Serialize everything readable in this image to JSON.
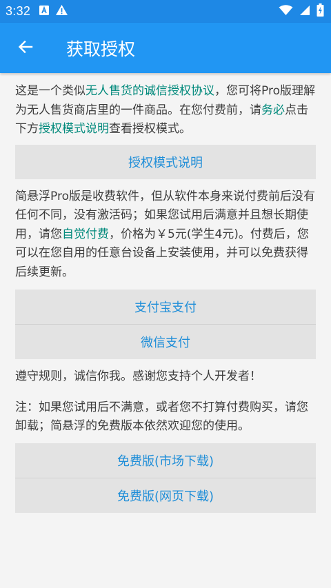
{
  "status_bar": {
    "time": "3:32",
    "left_icons": [
      "font-download-icon",
      "warning-icon"
    ],
    "right_icons": [
      "wifi-icon",
      "signal-icon",
      "battery-charging-icon"
    ]
  },
  "app_bar": {
    "back_icon": "arrow-left-icon",
    "title": "获取授权"
  },
  "intro": {
    "t1": "这是一个类似",
    "h1": "无人售货的诚信授权协议",
    "t2": "，您可将Pro版理解为无人售货商店里的一件商品。在您付费前，请",
    "h2": "务必",
    "t3": "点击下方",
    "h3": "授权模式说明",
    "t4": "查看授权模式。"
  },
  "auth_mode_button": "授权模式说明",
  "pricing": {
    "t1": "简悬浮Pro版是收费软件，但从软件本身来说付费前后没有任何不同，没有激活码；如果您试用后满意并且想长期使用，请您",
    "h1": "自觉付费",
    "t2": "，价格为￥5元(学生4元)。付费后，您可以在您自用的任意台设备上安装使用，并可以免费获得后续更新。"
  },
  "payment_buttons": {
    "alipay": "支付宝支付",
    "wechat": "微信支付"
  },
  "honor_note": "遵守规则，诚信你我。感谢您支持个人开发者！",
  "uninstall_note": "注：如果您试用后不满意，或者您不打算付费购买，请您卸载；简悬浮的免费版本依然欢迎您的使用。",
  "free_buttons": {
    "market": "免费版(市场下载)",
    "web": "免费版(网页下载)"
  },
  "colors": {
    "status_bar": "#1e88e5",
    "app_bar": "#2196f3",
    "highlight_text": "#00897b",
    "button_text": "#1f8ed8",
    "button_bg": "#e3e3e3",
    "page_bg": "#f4f4f4"
  }
}
